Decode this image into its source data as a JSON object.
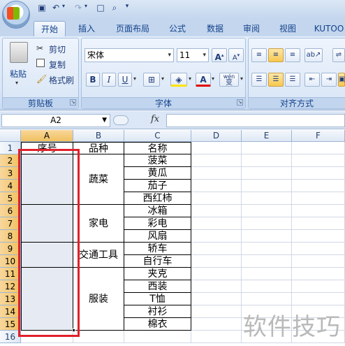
{
  "quick_access": [
    "save-icon",
    "undo-icon",
    "redo-icon",
    "new-icon",
    "print-preview-icon",
    "customize-icon"
  ],
  "tabs": [
    "开始",
    "插入",
    "页面布局",
    "公式",
    "数据",
    "审阅",
    "视图",
    "KUTOO"
  ],
  "clipboard": {
    "paste": "粘贴",
    "cut": "剪切",
    "copy": "复制",
    "format_painter": "格式刷",
    "label": "剪贴板"
  },
  "font": {
    "name": "宋体",
    "size": "11",
    "grow": "A",
    "shrink": "A",
    "bold": "B",
    "italic": "I",
    "underline": "U",
    "font_color": "A",
    "wen": "wén",
    "wen_char": "变",
    "label": "字体"
  },
  "alignment": {
    "label": "对齐方式"
  },
  "formula_bar": {
    "name_box": "A2",
    "fx": "fx",
    "formula": ""
  },
  "columns": [
    "A",
    "B",
    "C",
    "D",
    "E",
    "F"
  ],
  "rows": [
    "1",
    "2",
    "3",
    "4",
    "5",
    "6",
    "7",
    "8",
    "9",
    "10",
    "11",
    "12",
    "13",
    "14",
    "15",
    "16"
  ],
  "table": {
    "headers": [
      "序号",
      "品种",
      "名称"
    ],
    "categories": [
      "蔬菜",
      "家电",
      "交通工具",
      "服装"
    ],
    "names": [
      "菠菜",
      "黄瓜",
      "茄子",
      "西红柿",
      "冰箱",
      "彩电",
      "风扇",
      "轿车",
      "自行车",
      "夹克",
      "西装",
      "T恤",
      "衬衫",
      "棉衣"
    ]
  },
  "watermark": "软件技巧",
  "colors": {
    "selection_border": "#e0202b",
    "header_highlight": "#f1c15f",
    "ribbon_text": "#15428b"
  }
}
